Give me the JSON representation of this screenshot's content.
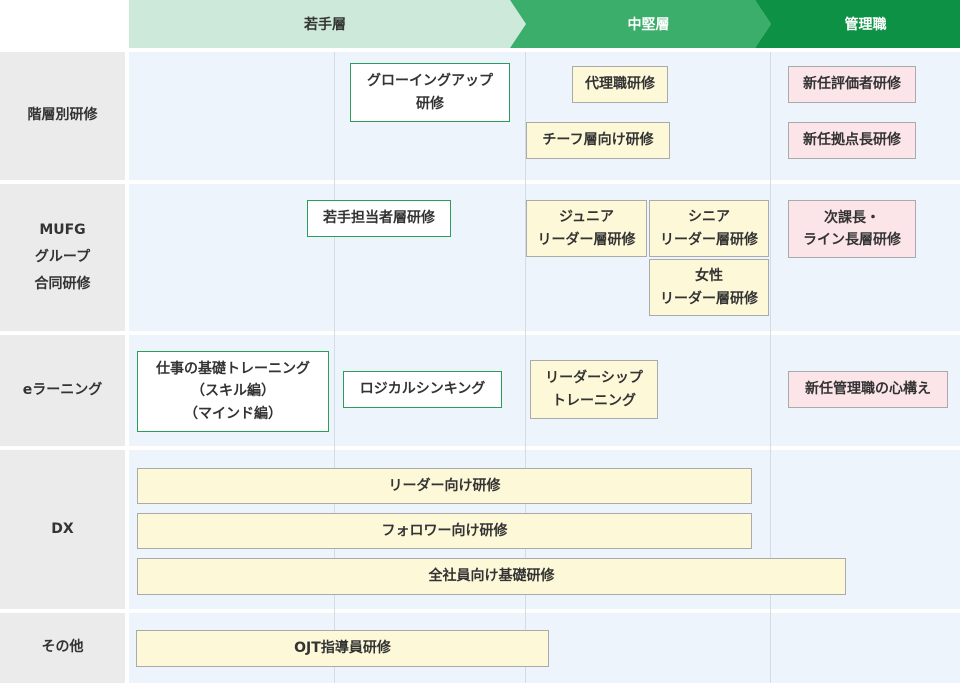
{
  "header": {
    "phases": [
      {
        "label": "若手層",
        "color": "#cde9d9",
        "text_color": "#333333"
      },
      {
        "label": "中堅層",
        "color": "#3cae6b",
        "text_color": "#ffffff"
      },
      {
        "label": "管理職",
        "color": "#0d9245",
        "text_color": "#ffffff"
      }
    ]
  },
  "rows": [
    {
      "label": "階層別研修"
    },
    {
      "label": "MUFG\nグループ\n合同研修"
    },
    {
      "label": "eラーニング"
    },
    {
      "label": "DX"
    },
    {
      "label": "その他"
    }
  ],
  "programs": {
    "growing_up": "グローイングアップ\n研修",
    "deputy": "代理職研修",
    "chief": "チーフ層向け研修",
    "new_evaluator": "新任評価者研修",
    "new_branch_manager": "新任拠点長研修",
    "young_staff": "若手担当者層研修",
    "junior_leader": "ジュニア\nリーダー層研修",
    "senior_leader": "シニア\nリーダー層研修",
    "female_leader": "女性\nリーダー層研修",
    "deputy_section_chief": "次課長・\nライン長層研修",
    "work_basics": "仕事の基礎トレーニング\n（スキル編）\n（マインド編）",
    "logical_thinking": "ロジカルシンキング",
    "leadership_training": "リーダーシップ\nトレーニング",
    "new_manager_mindset": "新任管理職の心構え",
    "dx_leader": "リーダー向け研修",
    "dx_follower": "フォロワー向け研修",
    "dx_all": "全社員向け基礎研修",
    "ojt": "OJT指導員研修"
  }
}
